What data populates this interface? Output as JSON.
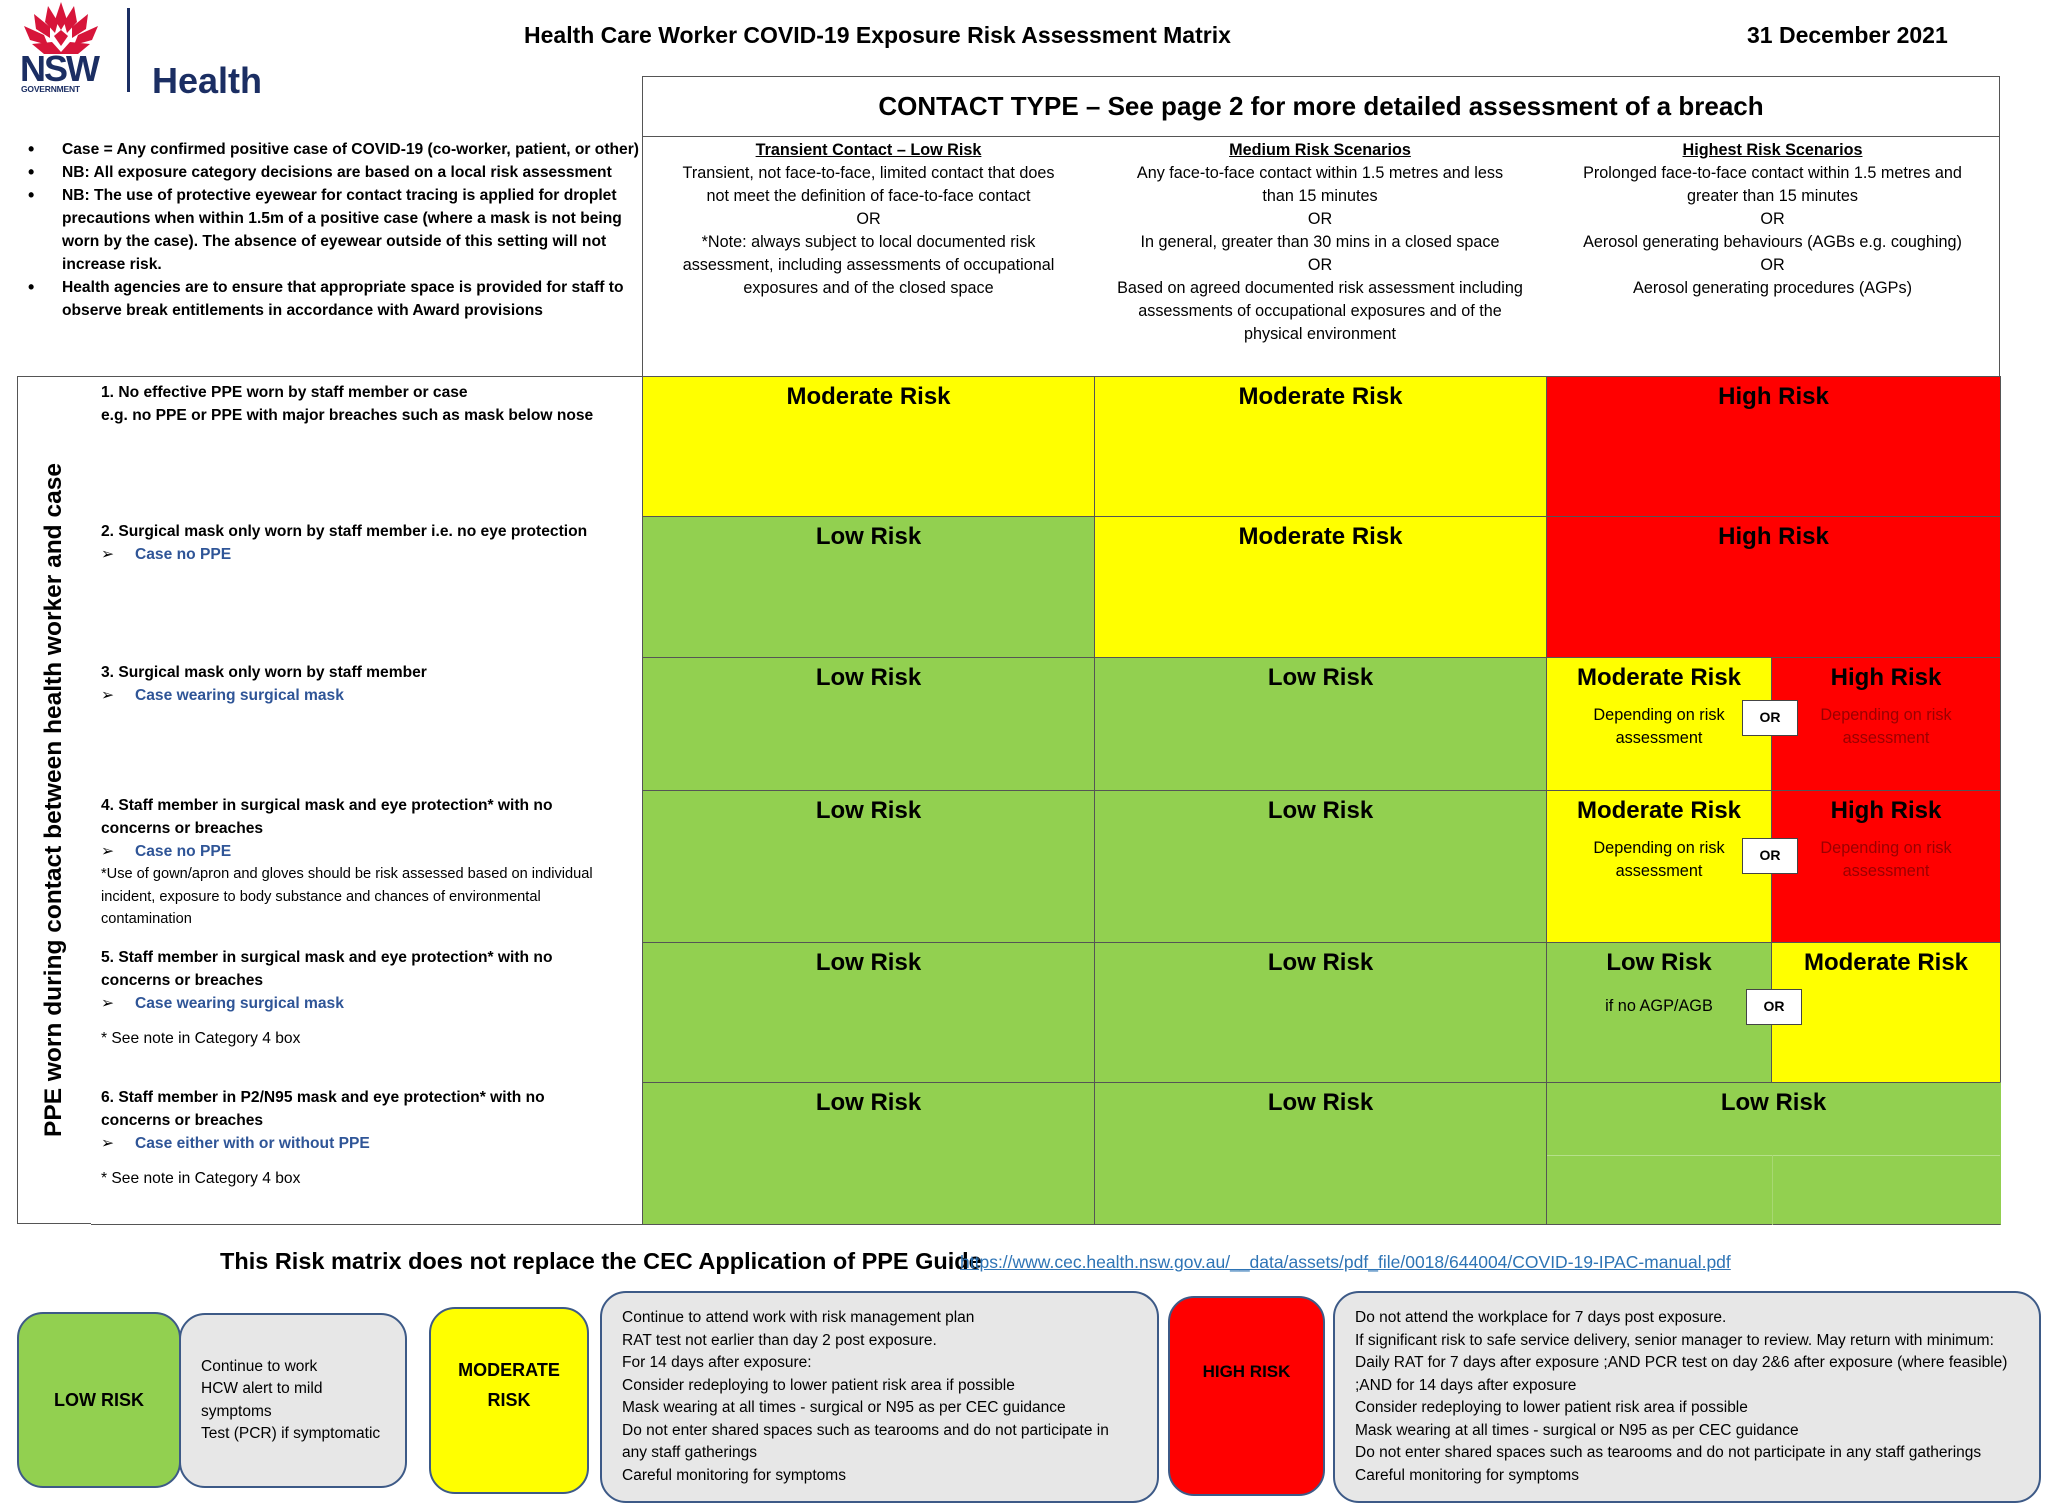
{
  "header": {
    "logo": {
      "brand": "NSW",
      "sub": "GOVERNMENT",
      "agency": "Health"
    },
    "title": "Health Care Worker COVID-19 Exposure Risk Assessment Matrix",
    "date": "31 December 2021"
  },
  "notes": [
    "Case = Any confirmed positive case of COVID-19 (co-worker, patient, or other)",
    "NB: All exposure category decisions are based on a local risk assessment",
    "NB: The use of protective eyewear for contact tracing is applied for droplet precautions when within 1.5m of a positive case (where a mask is not being worn by the case). The absence of eyewear outside of this setting will not increase risk.",
    "Health agencies are to ensure that appropriate space is provided for staff to observe break entitlements in accordance with Award provisions"
  ],
  "contact_type": {
    "title": "CONTACT TYPE – See page 2 for more detailed assessment of a breach",
    "columns": [
      {
        "heading": "Transient Contact – Low Risk",
        "lines": [
          "Transient, not face-to-face, limited contact that does",
          "not meet the definition of face-to-face contact",
          "OR",
          "*Note: always subject to local documented risk",
          "assessment, including assessments of occupational",
          "exposures and of the closed space"
        ]
      },
      {
        "heading": "Medium Risk Scenarios",
        "lines": [
          "Any face-to-face contact within 1.5 metres and less",
          "than 15 minutes",
          "OR",
          "In general, greater than 30 mins in a closed space",
          "OR",
          "Based on agreed documented risk assessment including",
          "assessments of occupational exposures and of the",
          "physical environment"
        ]
      },
      {
        "heading": "Highest Risk Scenarios",
        "lines": [
          "Prolonged face-to-face contact within 1.5 metres and",
          "greater than 15 minutes",
          "OR",
          "Aerosol generating behaviours (AGBs e.g. coughing)",
          "OR",
          "Aerosol generating procedures (AGPs)"
        ]
      }
    ]
  },
  "ppe_axis_label": "PPE worn during contact between health worker and case",
  "rows": [
    {
      "title_lines": [
        "1. No effective PPE worn by staff member or case",
        "e.g. no PPE or PPE with major breaches such as mask below nose"
      ],
      "case": "",
      "note": "",
      "see": "",
      "cells": [
        {
          "label": "Moderate Risk",
          "level": "moderate"
        },
        {
          "label": "Moderate Risk",
          "level": "moderate"
        },
        {
          "label": "High Risk",
          "level": "high"
        }
      ]
    },
    {
      "title_lines": [
        "2. Surgical mask only worn by staff member i.e. no eye protection"
      ],
      "case": "Case no PPE",
      "note": "",
      "see": "",
      "cells": [
        {
          "label": "Low Risk",
          "level": "low"
        },
        {
          "label": "Moderate Risk",
          "level": "moderate"
        },
        {
          "label": "High Risk",
          "level": "high"
        }
      ]
    },
    {
      "title_lines": [
        "3. Surgical mask only worn by staff member"
      ],
      "case": "Case wearing surgical mask",
      "note": "",
      "see": "",
      "cells": [
        {
          "label": "Low Risk",
          "level": "low"
        },
        {
          "label": "Low Risk",
          "level": "low"
        },
        {
          "split": true,
          "or": "OR",
          "left": {
            "label": "Moderate Risk",
            "level": "moderate",
            "sub": [
              "Depending on risk",
              "assessment"
            ]
          },
          "right": {
            "label": "High Risk",
            "level": "high",
            "sub": [
              "Depending on risk",
              "assessment"
            ]
          }
        }
      ]
    },
    {
      "title_lines": [
        "4. Staff member in surgical mask and eye protection* with no",
        "concerns or breaches"
      ],
      "case": "Case no PPE",
      "note": "*Use of gown/apron and gloves should be risk assessed based on individual incident, exposure to body substance and chances of environmental contamination",
      "see": "",
      "cells": [
        {
          "label": "Low Risk",
          "level": "low"
        },
        {
          "label": "Low Risk",
          "level": "low"
        },
        {
          "split": true,
          "or": "OR",
          "left": {
            "label": "Moderate Risk",
            "level": "moderate",
            "sub": [
              "Depending on risk",
              "assessment"
            ]
          },
          "right": {
            "label": "High Risk",
            "level": "high",
            "sub": [
              "Depending on risk",
              "assessment"
            ]
          }
        }
      ]
    },
    {
      "title_lines": [
        "5. Staff member in surgical mask and eye protection* with no",
        "concerns or breaches"
      ],
      "case": "Case wearing surgical mask",
      "note": "",
      "see": " * See note in Category 4 box",
      "cells": [
        {
          "label": "Low Risk",
          "level": "low"
        },
        {
          "label": "Low Risk",
          "level": "low"
        },
        {
          "split": true,
          "or": "OR",
          "left": {
            "label": "Low Risk",
            "level": "low",
            "sub": [
              "if no AGP/AGB"
            ]
          },
          "right": {
            "label": "Moderate Risk",
            "level": "moderate",
            "sub": []
          }
        }
      ]
    },
    {
      "title_lines": [
        "6. Staff member in P2/N95 mask and eye protection* with no",
        "concerns or breaches"
      ],
      "case": "Case either with or without PPE",
      "note": "",
      "see": "* See note in Category 4 box",
      "cells": [
        {
          "label": "Low Risk",
          "level": "low"
        },
        {
          "label": "Low Risk",
          "level": "low"
        },
        {
          "label": "Low Risk",
          "level": "low"
        }
      ]
    }
  ],
  "notice": {
    "text": "This Risk matrix does not replace the CEC Application of PPE Guide",
    "link": "https://www.cec.health.nsw.gov.au/__data/assets/pdf_file/0018/644004/COVID-19-IPAC-manual.pdf"
  },
  "legend": [
    {
      "level": "low",
      "label": "LOW RISK",
      "actions": [
        "Continue to work",
        "HCW alert to mild",
        "symptoms",
        "Test (PCR) if symptomatic"
      ]
    },
    {
      "level": "moderate",
      "label_lines": [
        "MODERATE",
        "RISK"
      ],
      "actions": [
        "Continue to attend work with risk management plan",
        "RAT test not earlier than day 2 post exposure.",
        " For 14 days after exposure:",
        "Consider redeploying to lower patient risk area if possible",
        "Mask wearing at all times - surgical or N95 as per CEC guidance",
        "Do not enter shared spaces such as tearooms and do not participate in",
        "any staff gatherings",
        "Careful monitoring for symptoms"
      ]
    },
    {
      "level": "high",
      "label": "HIGH RISK",
      "actions": [
        "Do not attend the workplace for 7 days post exposure.",
        "If significant risk to safe service delivery, senior manager to review. May return with minimum:",
        "Daily RAT for 7 days after exposure ;AND PCR test on day 2&6 after exposure (where feasible)",
        ";AND for 14 days after exposure",
        "Consider redeploying to lower patient risk area if possible",
        "Mask wearing at all times - surgical or N95 as per CEC guidance",
        "Do not enter shared spaces such as tearooms and do not participate in any staff gatherings",
        "Careful monitoring for symptoms"
      ]
    }
  ],
  "colors": {
    "low": "#92d050",
    "moderate": "#ffff00",
    "high": "#ff0000",
    "case_text": "#2f5597",
    "link": "#2e74b5",
    "brand_navy": "#1b2e63",
    "brand_red": "#d7153a",
    "legend_border": "#3d5a87",
    "legend_fill": "#e7e7e7"
  }
}
